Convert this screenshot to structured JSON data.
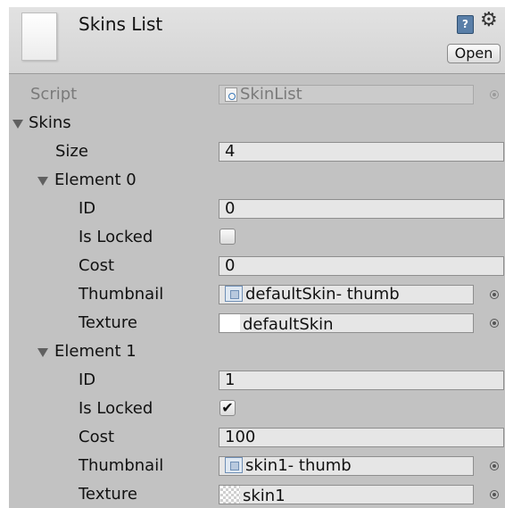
{
  "header": {
    "title": "Skins List",
    "help_icon_glyph": "?",
    "gear_icon_glyph": "⚙",
    "open_label": "Open"
  },
  "script_row": {
    "label": "Script",
    "value": "SkinList"
  },
  "skins": {
    "label": "Skins",
    "size_label": "Size",
    "size_value": "4",
    "elements": [
      {
        "label": "Element 0",
        "id_label": "ID",
        "id_value": "0",
        "locked_label": "Is Locked",
        "locked": false,
        "cost_label": "Cost",
        "cost_value": "0",
        "thumbnail_label": "Thumbnail",
        "thumbnail_value": "defaultSkin- thumb",
        "texture_label": "Texture",
        "texture_value": "defaultSkin"
      },
      {
        "label": "Element 1",
        "id_label": "ID",
        "id_value": "1",
        "locked_label": "Is Locked",
        "locked": true,
        "locked_glyph": "✔",
        "cost_label": "Cost",
        "cost_value": "100",
        "thumbnail_label": "Thumbnail",
        "thumbnail_value": "skin1- thumb",
        "texture_label": "Texture",
        "texture_value": "skin1"
      }
    ]
  },
  "colors": {
    "panel_bg": "#c2c2c2",
    "header_bg": "#dcdcdc",
    "field_bg": "#e6e6e6",
    "disabled_text": "#7a7a7a"
  }
}
